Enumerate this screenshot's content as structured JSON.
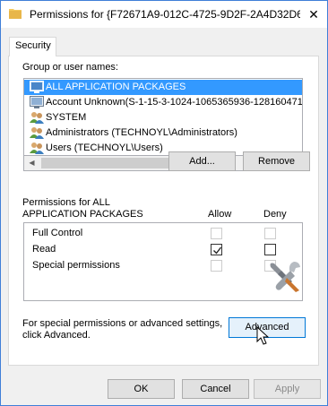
{
  "window": {
    "title": "Permissions for {F72671A9-012C-4725-9D2F-2A4D32D6",
    "close_glyph": "✕"
  },
  "tab": {
    "label": "Security"
  },
  "groups": {
    "label": "Group or user names:",
    "items": [
      {
        "label": "ALL APPLICATION PACKAGES",
        "icon": "app-packages-icon",
        "selected": true
      },
      {
        "label": "Account Unknown(S-1-15-3-1024-1065365936-1281604716",
        "icon": "unknown-account-icon"
      },
      {
        "label": "SYSTEM",
        "icon": "users-group-icon"
      },
      {
        "label": "Administrators (TECHNOYL\\Administrators)",
        "icon": "users-group-icon"
      },
      {
        "label": "Users (TECHNOYL\\Users)",
        "icon": "users-group-icon"
      }
    ],
    "add_label": "Add...",
    "remove_label": "Remove"
  },
  "permissions": {
    "header_line1": "Permissions for ALL",
    "header_line2": "APPLICATION PACKAGES",
    "allow_label": "Allow",
    "deny_label": "Deny",
    "rows": [
      {
        "label": "Full Control",
        "allow": false,
        "deny": false,
        "enabled": false
      },
      {
        "label": "Read",
        "allow": true,
        "deny": false,
        "enabled": true
      },
      {
        "label": "Special permissions",
        "allow": false,
        "deny": false,
        "enabled": false
      }
    ]
  },
  "advanced": {
    "hint_line1": "For special permissions or advanced settings,",
    "hint_line2": "click Advanced.",
    "button_label": "Advanced"
  },
  "footer": {
    "ok_label": "OK",
    "cancel_label": "Cancel",
    "apply_label": "Apply"
  },
  "colors": {
    "selection": "#3399ff",
    "focus_border": "#0078d7",
    "window_border": "#3f7fd8"
  }
}
